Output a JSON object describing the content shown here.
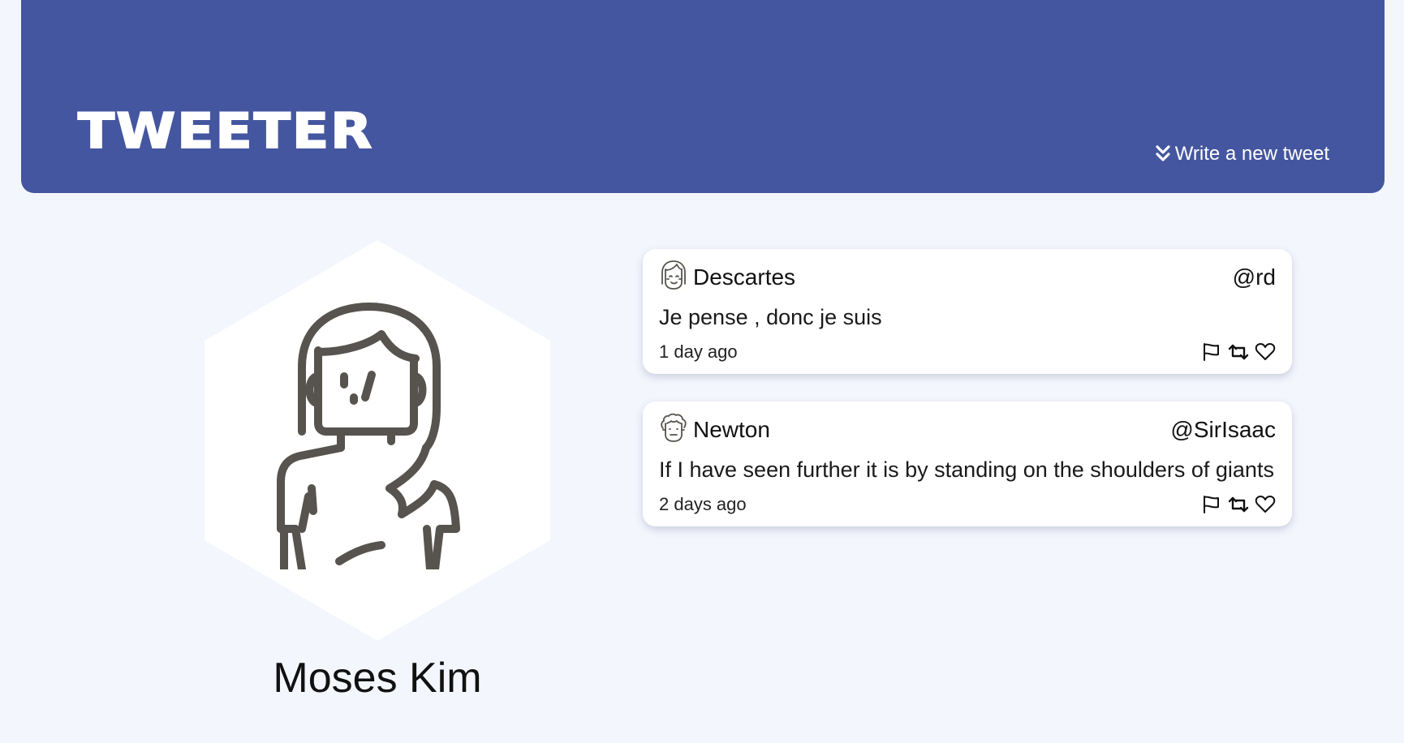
{
  "header": {
    "brand": "TWEETER",
    "compose_label": "Write a new tweet",
    "background": "#4556a0"
  },
  "profile": {
    "name": "Moses Kim",
    "avatar_icon": "woman-avatar-icon"
  },
  "tweets": [
    {
      "author": "Descartes",
      "handle": "@rd",
      "text": "Je pense , donc je suis",
      "time": "1 day ago",
      "avatar_icon": "girl-face-icon"
    },
    {
      "author": "Newton",
      "handle": "@SirIsaac",
      "text": "If I have seen further it is by standing on the shoulders of giants",
      "time": "2 days ago",
      "avatar_icon": "curly-hair-face-icon"
    }
  ],
  "actions": [
    "flag-icon",
    "retweet-icon",
    "heart-icon"
  ],
  "colors": {
    "page_background": "#f4f6fe",
    "card_background": "#ffffff",
    "icon_stroke": "#57534e"
  }
}
